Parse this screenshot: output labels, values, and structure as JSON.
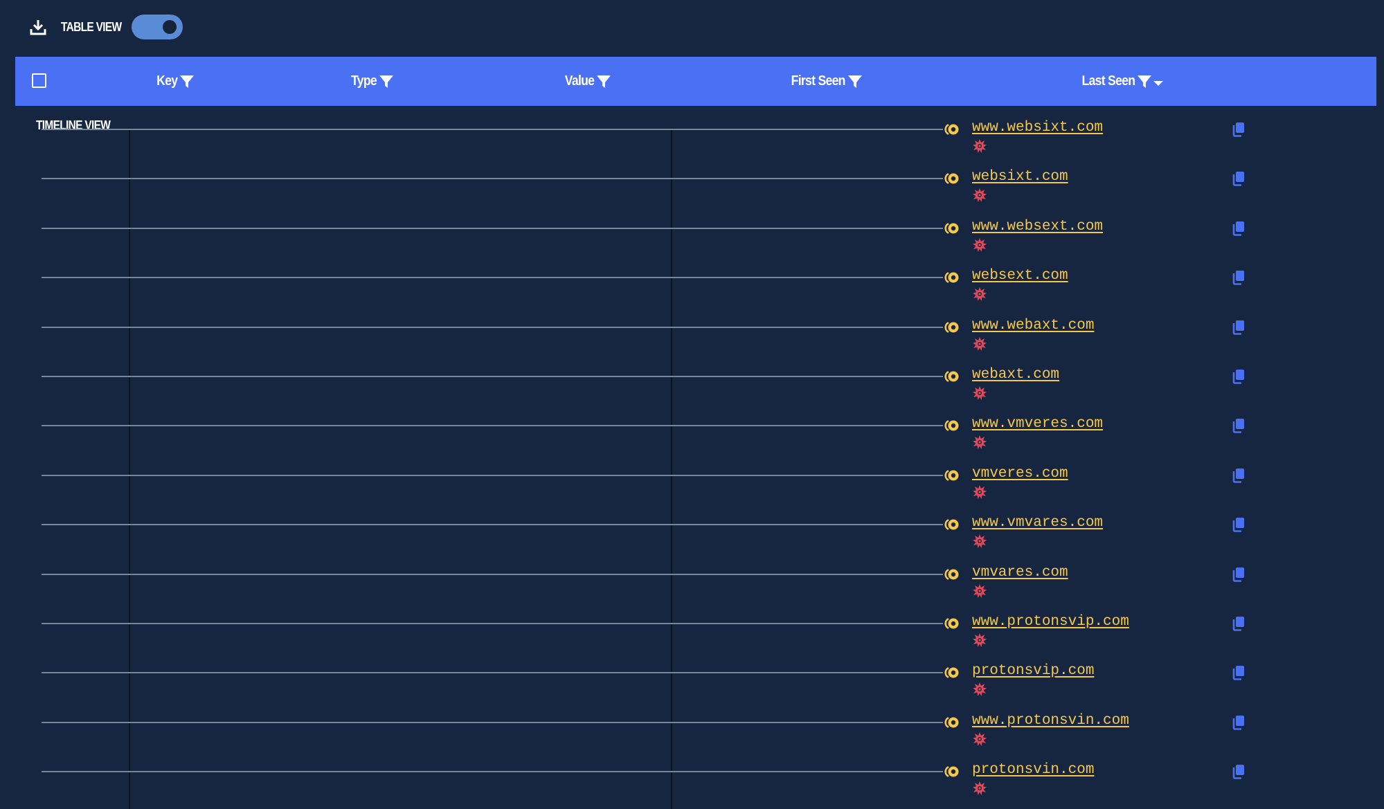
{
  "toolbar": {
    "download_icon": "download-icon",
    "table_view_label": "TABLE VIEW",
    "timeline_view_label": "TIMELINE VIEW",
    "toggle_state": "timeline"
  },
  "header": {
    "columns": [
      {
        "label": "Key",
        "icon": "filter-icon"
      },
      {
        "label": "Type",
        "icon": "filter-icon"
      },
      {
        "label": "Value",
        "icon": "filter-icon"
      },
      {
        "label": "First Seen",
        "icon": "filter-icon"
      },
      {
        "label": "Last Seen",
        "icon": "filter-icon",
        "sort": "descending"
      }
    ]
  },
  "colors": {
    "background": "#172640",
    "header": "#4a70f3",
    "link": "#f5c84b",
    "threat": "#e04a5a",
    "copy": "#4a70f3"
  },
  "rows": [
    {
      "domain": "www.websixt.com"
    },
    {
      "domain": "websixt.com"
    },
    {
      "domain": "www.websext.com"
    },
    {
      "domain": "websext.com"
    },
    {
      "domain": "www.webaxt.com"
    },
    {
      "domain": "webaxt.com"
    },
    {
      "domain": "www.vmveres.com"
    },
    {
      "domain": "vmveres.com"
    },
    {
      "domain": "www.vmvares.com"
    },
    {
      "domain": "vmvares.com"
    },
    {
      "domain": "www.protonsvip.com"
    },
    {
      "domain": "protonsvip.com"
    },
    {
      "domain": "www.protonsvin.com"
    },
    {
      "domain": "protonsvin.com"
    }
  ]
}
